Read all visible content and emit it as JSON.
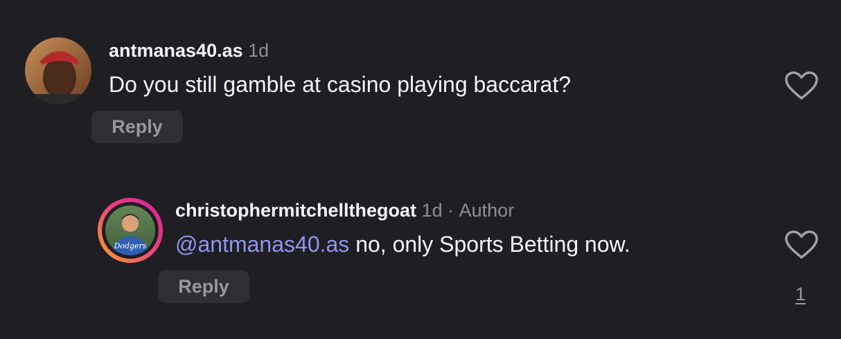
{
  "comment": {
    "username": "antmanas40.as",
    "time": "1d",
    "text": "Do you still gamble at casino playing  baccarat?",
    "reply_label": "Reply",
    "avatar_icon": "user-avatar-icon",
    "like_icon": "heart-outline-icon"
  },
  "reply": {
    "username": "christophermitchellthegoat",
    "time": "1d",
    "separator": "·",
    "badge": "Author",
    "mention": "@antmanas40.as",
    "text": "no, only Sports Betting now.",
    "reply_label": "Reply",
    "avatar_icon": "user-avatar-story-ring-icon",
    "like_icon": "heart-outline-icon",
    "like_count": "1"
  },
  "colors": {
    "background": "#1f1f23",
    "mention": "#8f95f2",
    "muted": "#8e8e93",
    "story_ring_start": "#f9a825",
    "story_ring_end": "#d81b9f"
  }
}
